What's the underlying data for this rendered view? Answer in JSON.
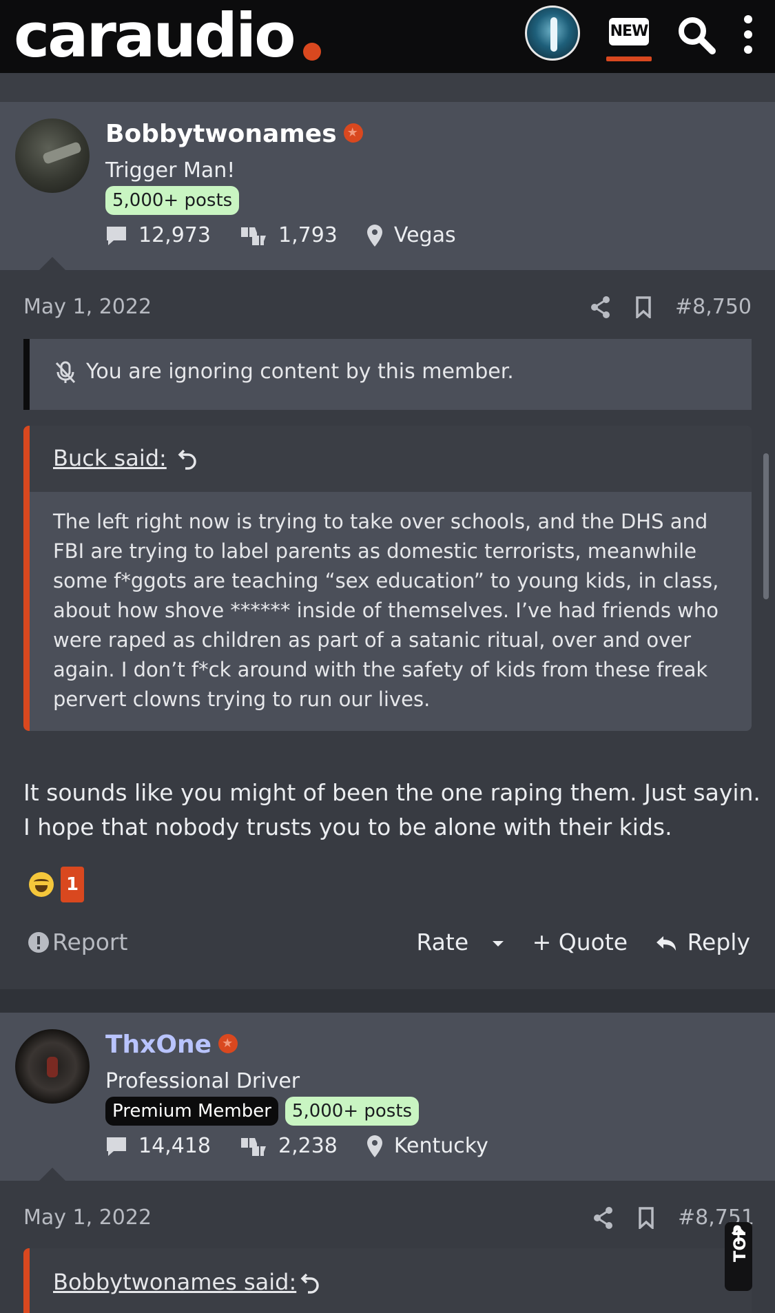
{
  "header": {
    "logo_text": "caraudio",
    "new_label": "NEW",
    "accent_color": "#d9481f"
  },
  "posts": [
    {
      "author": "Bobbytwonames",
      "user_title": "Trigger Man!",
      "badges": [
        "5,000+ posts"
      ],
      "messages": "12,973",
      "reaction_score": "1,793",
      "location": "Vegas",
      "date": "May 1, 2022",
      "number": "#8,750",
      "ignored_notice": "You are ignoring content by this member.",
      "quote": {
        "author_label": "Buck said:",
        "text": "The left right now is trying to take over schools, and the DHS and FBI are trying to label parents as domestic terrorists, meanwhile some f*ggots are teaching “sex education” to young kids, in class, about how shove ****** inside of themselves. I’ve had friends who were raped as children as part of a satanic ritual, over and over again. I don’t f*ck around with the safety of kids from these freak pervert clowns trying to run our lives."
      },
      "body": "It sounds like you might of been the one raping them. Just sayin. I hope that nobody trusts you to be alone with their kids.",
      "reaction_count": "1",
      "footer": {
        "report": "Report",
        "rate": "Rate",
        "quote": "+ Quote",
        "reply": "Reply"
      }
    },
    {
      "author": "ThxOne",
      "user_title": "Professional Driver",
      "badges": [
        "Premium Member",
        "5,000+ posts"
      ],
      "messages": "14,418",
      "reaction_score": "2,238",
      "location": "Kentucky",
      "date": "May 1, 2022",
      "number": "#8,751",
      "quote": {
        "author_label": "Bobbytwonames said:"
      }
    }
  ],
  "top_button": "TOP"
}
